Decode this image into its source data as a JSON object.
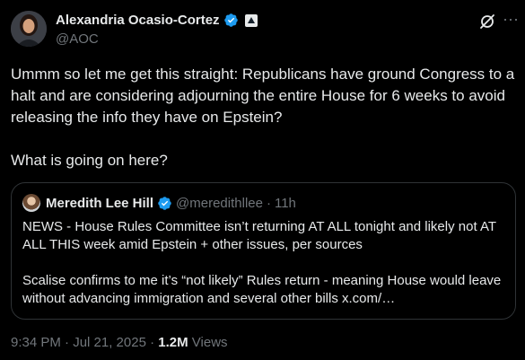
{
  "author": {
    "name": "Alexandria Ocasio-Cortez",
    "handle": "@AOC"
  },
  "tweet": {
    "paragraphs": [
      "Ummm so let me get this straight: Republicans have ground Congress to a halt and are considering adjourning the entire House for 6 weeks to avoid releasing the info they have on Epstein?",
      "What is going on here?"
    ]
  },
  "quote": {
    "name": "Meredith Lee Hill",
    "handle": "@meredithllee",
    "separator": "·",
    "time": "11h",
    "paragraphs": [
      "NEWS - House Rules Committee isn’t returning AT ALL tonight and likely not AT ALL THIS week amid Epstein + other issues, per sources",
      "Scalise confirms to me it’s “not likely” Rules return - meaning House would leave without advancing immigration and several other bills x.com/…"
    ]
  },
  "meta": {
    "timestamp": "9:34 PM · Jul 21, 2025 · ",
    "views_count": "1.2M",
    "views_label": " Views"
  },
  "icons": {
    "verified": "verified-badge-icon",
    "government": "government-affiliation-icon",
    "grok": "grok-icon",
    "more": "more-options-icon"
  },
  "colors": {
    "background": "#000000",
    "text": "#e7e9ea",
    "secondary": "#71767b",
    "verified": "#1d9bf0",
    "border": "#2f3336"
  }
}
